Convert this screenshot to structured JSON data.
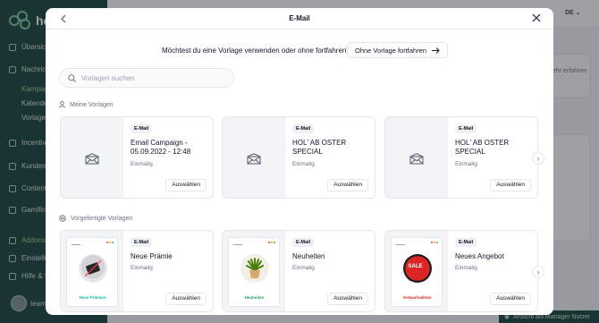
{
  "sidebar": {
    "brand": "he ag",
    "items": [
      {
        "label": "Übersicht",
        "top": 0
      },
      {
        "label": "Nachrichten"
      },
      {
        "label": "Incentives"
      },
      {
        "label": "Kunden"
      },
      {
        "label": "Content"
      },
      {
        "label": "Gamification"
      },
      {
        "label": "Addons"
      },
      {
        "label": "Einstellungen"
      },
      {
        "label": "Hilfe & Support"
      }
    ],
    "subitems": [
      "Kampagnen",
      "Kalender",
      "Vorlagen"
    ],
    "user": "team"
  },
  "background": {
    "language": "DE",
    "hint_text": "ehr erfahren",
    "impersonation": "Ansicht als Manager Nutzer"
  },
  "modal": {
    "title": "E-Mail",
    "question": "Möchtest du eine Vorlage verwenden oder ohne fortfahren?",
    "continue_label": "Ohne Vorlage fortfahren",
    "search_placeholder": "Vorlagen suchen",
    "my_templates_label": "Meine Vorlagen",
    "prebuilt_label": "Vorgefertigte Vorlagen",
    "my_templates": [
      {
        "badge": "E-Mail",
        "title": "Email Campaign - 05.09.2022 - 12:48",
        "frequency": "Einmalig",
        "select": "Auswählen"
      },
      {
        "badge": "E-Mail",
        "title": "HOL' AB OSTER SPECIAL",
        "frequency": "Einmalig",
        "select": "Auswählen"
      },
      {
        "badge": "E-Mail",
        "title": "HOL' AB OSTER SPECIAL",
        "frequency": "Einmalig",
        "select": "Auswählen"
      }
    ],
    "prebuilt_templates": [
      {
        "badge": "E-Mail",
        "title": "Neue Prämie",
        "frequency": "Einmalig",
        "select": "Auswählen",
        "preview_caption": "Neue Prämien",
        "caption_color": "#14b8a6"
      },
      {
        "badge": "E-Mail",
        "title": "Neuheiten",
        "frequency": "Einmalig",
        "select": "Auswählen",
        "preview_caption": "Neuheiten",
        "caption_color": "#22a45d"
      },
      {
        "badge": "E-Mail",
        "title": "Neues Angebot",
        "frequency": "Einmalig",
        "select": "Auswählen",
        "preview_caption": "Verkaufsaktion",
        "caption_color": "#dc2626",
        "sale_label": "SALE"
      }
    ]
  }
}
